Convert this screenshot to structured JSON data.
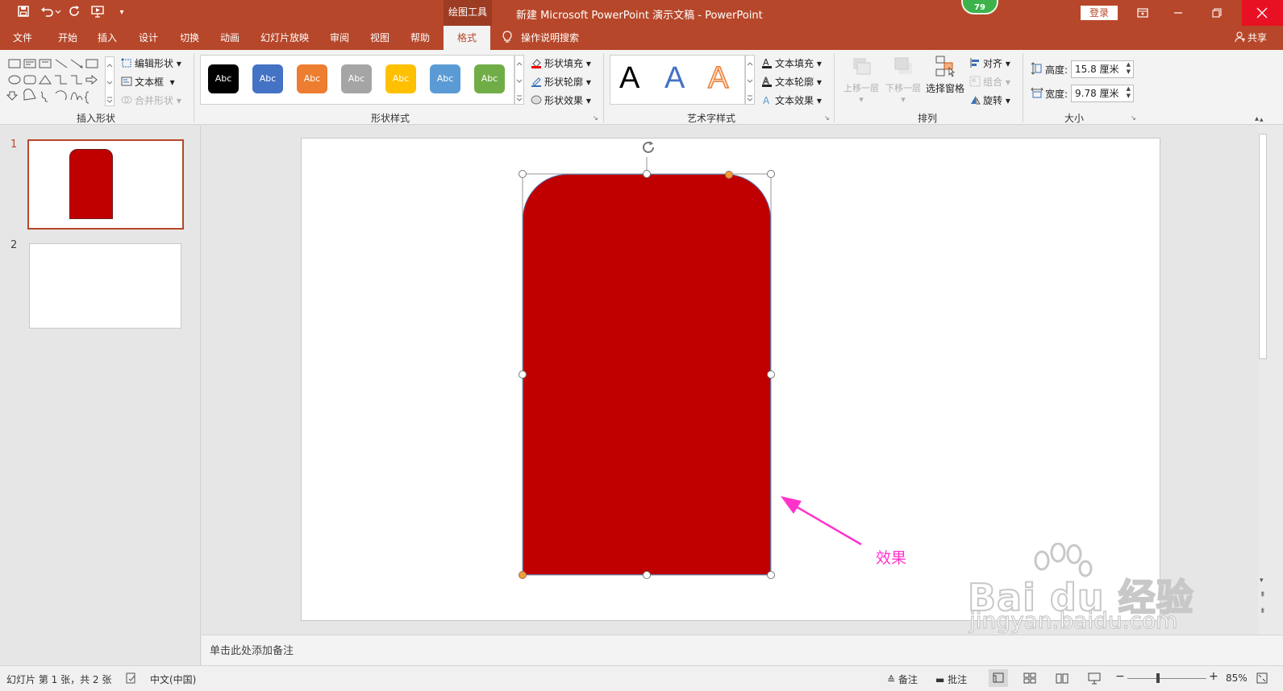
{
  "window": {
    "title": "新建 Microsoft PowerPoint 演示文稿  -  PowerPoint",
    "context_tab_group": "绘图工具",
    "login_label": "登录",
    "badge_count": "79",
    "share_label": "共享"
  },
  "ribbon_tabs": [
    {
      "label": "文件"
    },
    {
      "label": "开始"
    },
    {
      "label": "插入"
    },
    {
      "label": "设计"
    },
    {
      "label": "切换"
    },
    {
      "label": "动画"
    },
    {
      "label": "幻灯片放映"
    },
    {
      "label": "审阅"
    },
    {
      "label": "视图"
    },
    {
      "label": "帮助"
    },
    {
      "label": "格式",
      "active": true
    }
  ],
  "search_label": "操作说明搜索",
  "ribbon": {
    "insert_shapes": {
      "label": "插入形状",
      "edit_shape": "编辑形状",
      "text_box": "文本框",
      "merge_shapes": "合并形状"
    },
    "shape_styles": {
      "label": "形状样式",
      "presets": [
        {
          "text": "Abc",
          "color": "#000000"
        },
        {
          "text": "Abc",
          "color": "#4472c4"
        },
        {
          "text": "Abc",
          "color": "#ed7d31"
        },
        {
          "text": "Abc",
          "color": "#a5a5a5"
        },
        {
          "text": "Abc",
          "color": "#ffc000"
        },
        {
          "text": "Abc",
          "color": "#5b9bd5"
        },
        {
          "text": "Abc",
          "color": "#70ad47"
        }
      ],
      "fill": "形状填充",
      "outline": "形状轮廓",
      "effects": "形状效果"
    },
    "wordart": {
      "label": "艺术字样式",
      "letters": [
        "A",
        "A",
        "A"
      ],
      "text_fill": "文本填充",
      "text_outline": "文本轮廓",
      "text_effects": "文本效果"
    },
    "arrange": {
      "label": "排列",
      "bring_forward": "上移一层",
      "send_backward": "下移一层",
      "selection_pane": "选择窗格",
      "align": "对齐",
      "group": "组合",
      "rotate": "旋转"
    },
    "size": {
      "label": "大小",
      "height_label": "高度:",
      "height_value": "15.8 厘米",
      "width_label": "宽度:",
      "width_value": "9.78 厘米"
    }
  },
  "thumbnails": [
    {
      "number": "1"
    },
    {
      "number": "2"
    }
  ],
  "slide": {
    "shape_color": "#c00000",
    "annotation_text": "效果",
    "annotation_color": "#ff33cc"
  },
  "watermark": {
    "brand": "Bai du 经验",
    "url": "jingyan.baidu.com"
  },
  "notes_placeholder": "单击此处添加备注",
  "status": {
    "slide_info": "幻灯片 第 1 张，共 2 张",
    "language": "中文(中国)",
    "notes_btn": "备注",
    "comments_btn": "批注",
    "zoom": "85%"
  },
  "colors": {
    "accent": "#b7472a",
    "ribbon_bg": "#f3f3f3"
  }
}
